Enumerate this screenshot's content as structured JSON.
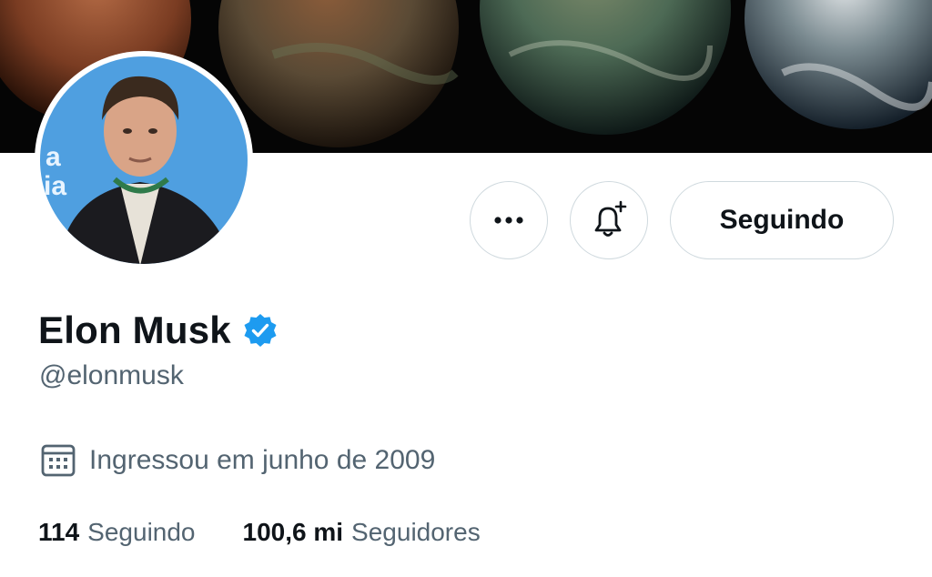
{
  "profile": {
    "name": "Elon Musk",
    "handle": "@elonmusk",
    "verified": true,
    "joined": "Ingressou em junho de 2009",
    "stats": [
      {
        "value": "114",
        "label": "Seguindo"
      },
      {
        "value": "100,6 mi",
        "label": "Seguidores"
      }
    ]
  },
  "actions": {
    "more_icon": "more-horizontal-icon",
    "notify_icon": "bell-plus-icon",
    "follow_label": "Seguindo"
  },
  "avatar": {
    "background_text": "a ia"
  },
  "colors": {
    "text_primary": "#0f1419",
    "text_secondary": "#536471",
    "verified_blue": "#1d9bf0",
    "button_border": "#cfd9de"
  },
  "icons": {
    "verified": "verified-badge-icon",
    "joined": "calendar-icon"
  }
}
